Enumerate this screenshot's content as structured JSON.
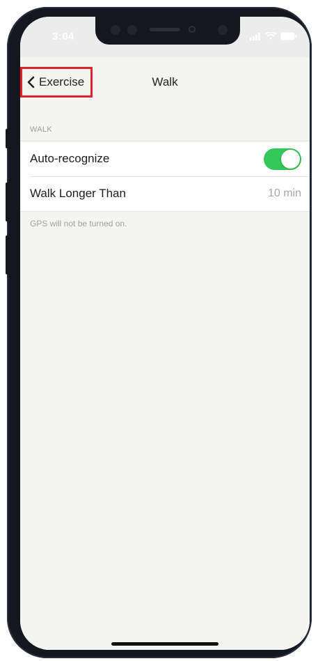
{
  "status": {
    "time": "3:04"
  },
  "nav": {
    "back_label": "Exercise",
    "title": "Walk"
  },
  "section": {
    "header": "WALK",
    "rows": [
      {
        "label": "Auto-recognize",
        "toggle_on": true
      },
      {
        "label": "Walk Longer Than",
        "value": "10 min"
      }
    ],
    "footnote": "GPS will not be turned on."
  },
  "colors": {
    "toggle_on": "#34c759",
    "highlight_box": "#e0232b"
  },
  "icons": {
    "back": "chevron-left-icon",
    "signal": "signal-icon",
    "wifi": "wifi-icon",
    "battery": "battery-icon"
  }
}
